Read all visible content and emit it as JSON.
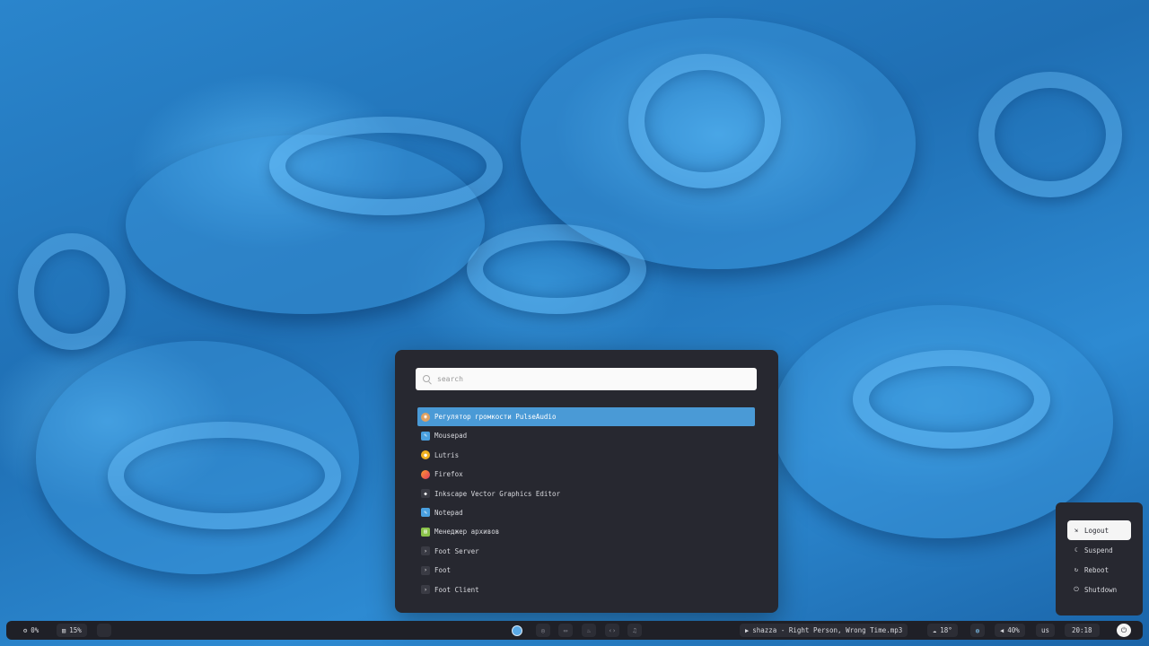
{
  "launcher": {
    "search_placeholder": "search",
    "apps": [
      {
        "label": "Регулятор громкости PulseAudio",
        "icon": "speaker-icon",
        "selected": true
      },
      {
        "label": "Mousepad",
        "icon": "text-editor-icon"
      },
      {
        "label": "Lutris",
        "icon": "lutris-icon"
      },
      {
        "label": "Firefox",
        "icon": "firefox-icon"
      },
      {
        "label": "Inkscape Vector Graphics Editor",
        "icon": "inkscape-icon"
      },
      {
        "label": "Notepad",
        "icon": "notepad-icon"
      },
      {
        "label": "Менеджер архивов",
        "icon": "archive-icon"
      },
      {
        "label": "Foot Server",
        "icon": "terminal-icon"
      },
      {
        "label": "Foot",
        "icon": "terminal-icon"
      },
      {
        "label": "Foot Client",
        "icon": "terminal-icon"
      }
    ]
  },
  "power_menu": {
    "items": [
      {
        "label": "Logout",
        "icon": "logout-icon",
        "selected": true
      },
      {
        "label": "Suspend",
        "icon": "moon-icon"
      },
      {
        "label": "Reboot",
        "icon": "reboot-icon"
      },
      {
        "label": "Shutdown",
        "icon": "power-icon"
      }
    ]
  },
  "bar": {
    "cpu": "0%",
    "memory": "15%",
    "now_playing": "shazza - Right Person, Wrong Time.mp3",
    "weather": "18°",
    "volume": "40%",
    "keyboard_layout": "us",
    "clock": "20:18"
  },
  "colors": {
    "accent": "#4a9ad6",
    "panel": "#272830",
    "bar": "#1f2027"
  }
}
